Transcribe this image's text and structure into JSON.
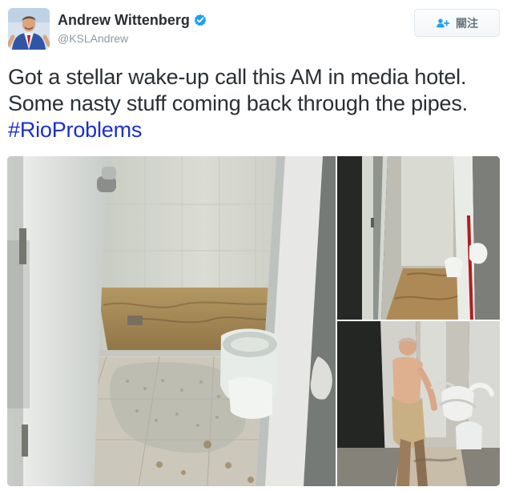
{
  "tweet": {
    "author": {
      "name": "Andrew Wittenberg",
      "handle": "@KSLAndrew",
      "verified": true,
      "avatar_icon": "user-avatar"
    },
    "follow_button": {
      "label": "關注",
      "icon": "add-user-icon"
    },
    "text": {
      "body": "Got a stellar wake-up call this AM in media hotel. Some nasty stuff coming back through the pipes.",
      "hashtag": "#RioProblems"
    },
    "media": {
      "photo_count": 3,
      "photos": [
        {
          "icon": "bathroom-photo-main"
        },
        {
          "icon": "bathroom-photo-doorway"
        },
        {
          "icon": "bathroom-photo-person"
        }
      ]
    },
    "colors": {
      "hashtag": "#1b2fcf",
      "verified": "#1da1f2",
      "text": "#292f33",
      "secondary": "#8899a6",
      "follow_icon": "#1da1f2"
    }
  }
}
